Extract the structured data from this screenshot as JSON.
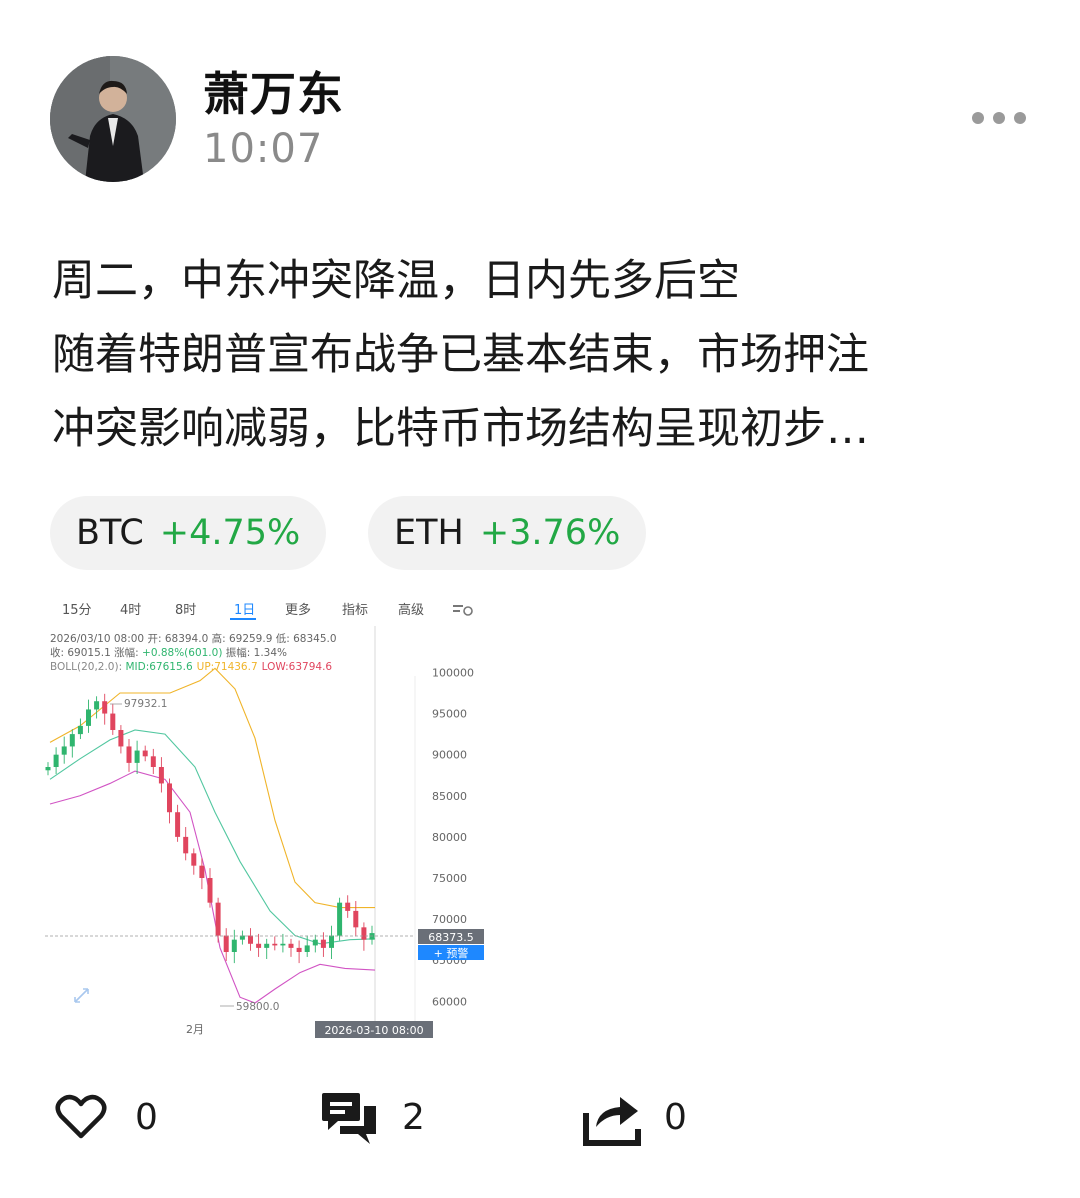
{
  "post": {
    "author": "萧万东",
    "time": "10:07",
    "lines": [
      "周二，中东冲突降温，日内先多后空",
      "随着特朗普宣布战争已基本结束，市场押注",
      "冲突影响减弱，比特币市场结构呈现初步…"
    ]
  },
  "tickers": [
    {
      "symbol": "BTC",
      "change": "+4.75%"
    },
    {
      "symbol": "ETH",
      "change": "+3.76%"
    }
  ],
  "chart": {
    "tabs": [
      "15分",
      "4时",
      "8时",
      "1日",
      "更多",
      "指标",
      "高级"
    ],
    "info1": "2026/03/10 08:00 开: 68394.0 高: 69259.9 低: 68345.0",
    "info2_close": "收: 69015.1 涨幅: ",
    "info2_change": "+0.88%(601.0)",
    "info2_amp": " 振幅: 1.34%",
    "boll_label": "BOLL(20,2.0): ",
    "boll_mid": "MID:67615.6",
    "boll_up": "UP:71436.7",
    "boll_low": "LOW:63794.6",
    "high_mark": "97932.1",
    "low_mark": "59800.0",
    "price_tag": "68373.5",
    "alert_button": "+ 预警",
    "x_month": "2月",
    "crosshair_date": "2026-03-10 08:00",
    "colors": {
      "up": "#2fb56e",
      "down": "#e0455e",
      "mid": "#52c7a0",
      "upper": "#f0b429",
      "lower": "#d154c4",
      "alert": "#1e88ff"
    }
  },
  "chart_data": {
    "type": "candlestick",
    "y_ticks": [
      "100000",
      "95000",
      "90000",
      "85000",
      "80000",
      "75000",
      "70000",
      "65000",
      "60000"
    ],
    "ylim": [
      57000,
      102000
    ]
  },
  "actions": {
    "likes": "0",
    "comments": "2",
    "shares": "0"
  }
}
